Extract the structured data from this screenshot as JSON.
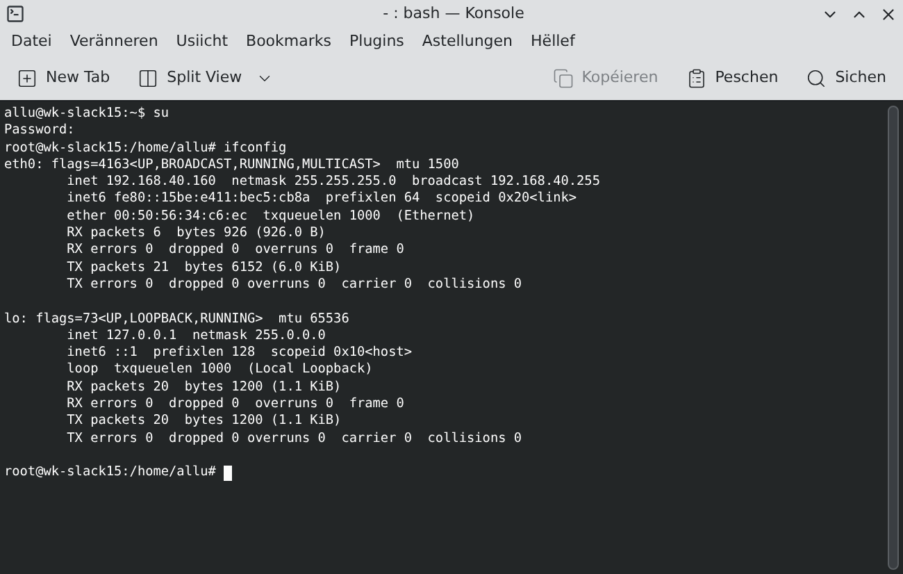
{
  "window": {
    "title": "- : bash — Konsole"
  },
  "menu": [
    "Datei",
    "Veränneren",
    "Usiicht",
    "Bookmarks",
    "Plugins",
    "Astellungen",
    "Hëllef"
  ],
  "toolbar": {
    "left": [
      {
        "kind": "new-tab",
        "label": "New Tab",
        "disabled": false
      },
      {
        "kind": "split",
        "label": "Split View",
        "disabled": false
      }
    ],
    "right": [
      {
        "kind": "copy",
        "label": "Kopéieren",
        "disabled": true
      },
      {
        "kind": "paste",
        "label": "Peschen",
        "disabled": false
      },
      {
        "kind": "search",
        "label": "Sichen",
        "disabled": false
      }
    ]
  },
  "terminal": {
    "blocks": [
      [
        "allu@wk-slack15:~$ su",
        "Password:",
        "root@wk-slack15:/home/allu# ifconfig",
        "eth0: flags=4163<UP,BROADCAST,RUNNING,MULTICAST>  mtu 1500",
        "        inet 192.168.40.160  netmask 255.255.255.0  broadcast 192.168.40.255",
        "        inet6 fe80::15be:e411:bec5:cb8a  prefixlen 64  scopeid 0x20<link>",
        "        ether 00:50:56:34:c6:ec  txqueuelen 1000  (Ethernet)",
        "        RX packets 6  bytes 926 (926.0 B)",
        "        RX errors 0  dropped 0  overruns 0  frame 0",
        "        TX packets 21  bytes 6152 (6.0 KiB)",
        "        TX errors 0  dropped 0 overruns 0  carrier 0  collisions 0"
      ],
      [
        "lo: flags=73<UP,LOOPBACK,RUNNING>  mtu 65536",
        "        inet 127.0.0.1  netmask 255.0.0.0",
        "        inet6 ::1  prefixlen 128  scopeid 0x10<host>",
        "        loop  txqueuelen 1000  (Local Loopback)",
        "        RX packets 20  bytes 1200 (1.1 KiB)",
        "        RX errors 0  dropped 0  overruns 0  frame 0",
        "        TX packets 20  bytes 1200 (1.1 KiB)",
        "        TX errors 0  dropped 0 overruns 0  carrier 0  collisions 0"
      ]
    ],
    "prompt": "root@wk-slack15:/home/allu#"
  }
}
